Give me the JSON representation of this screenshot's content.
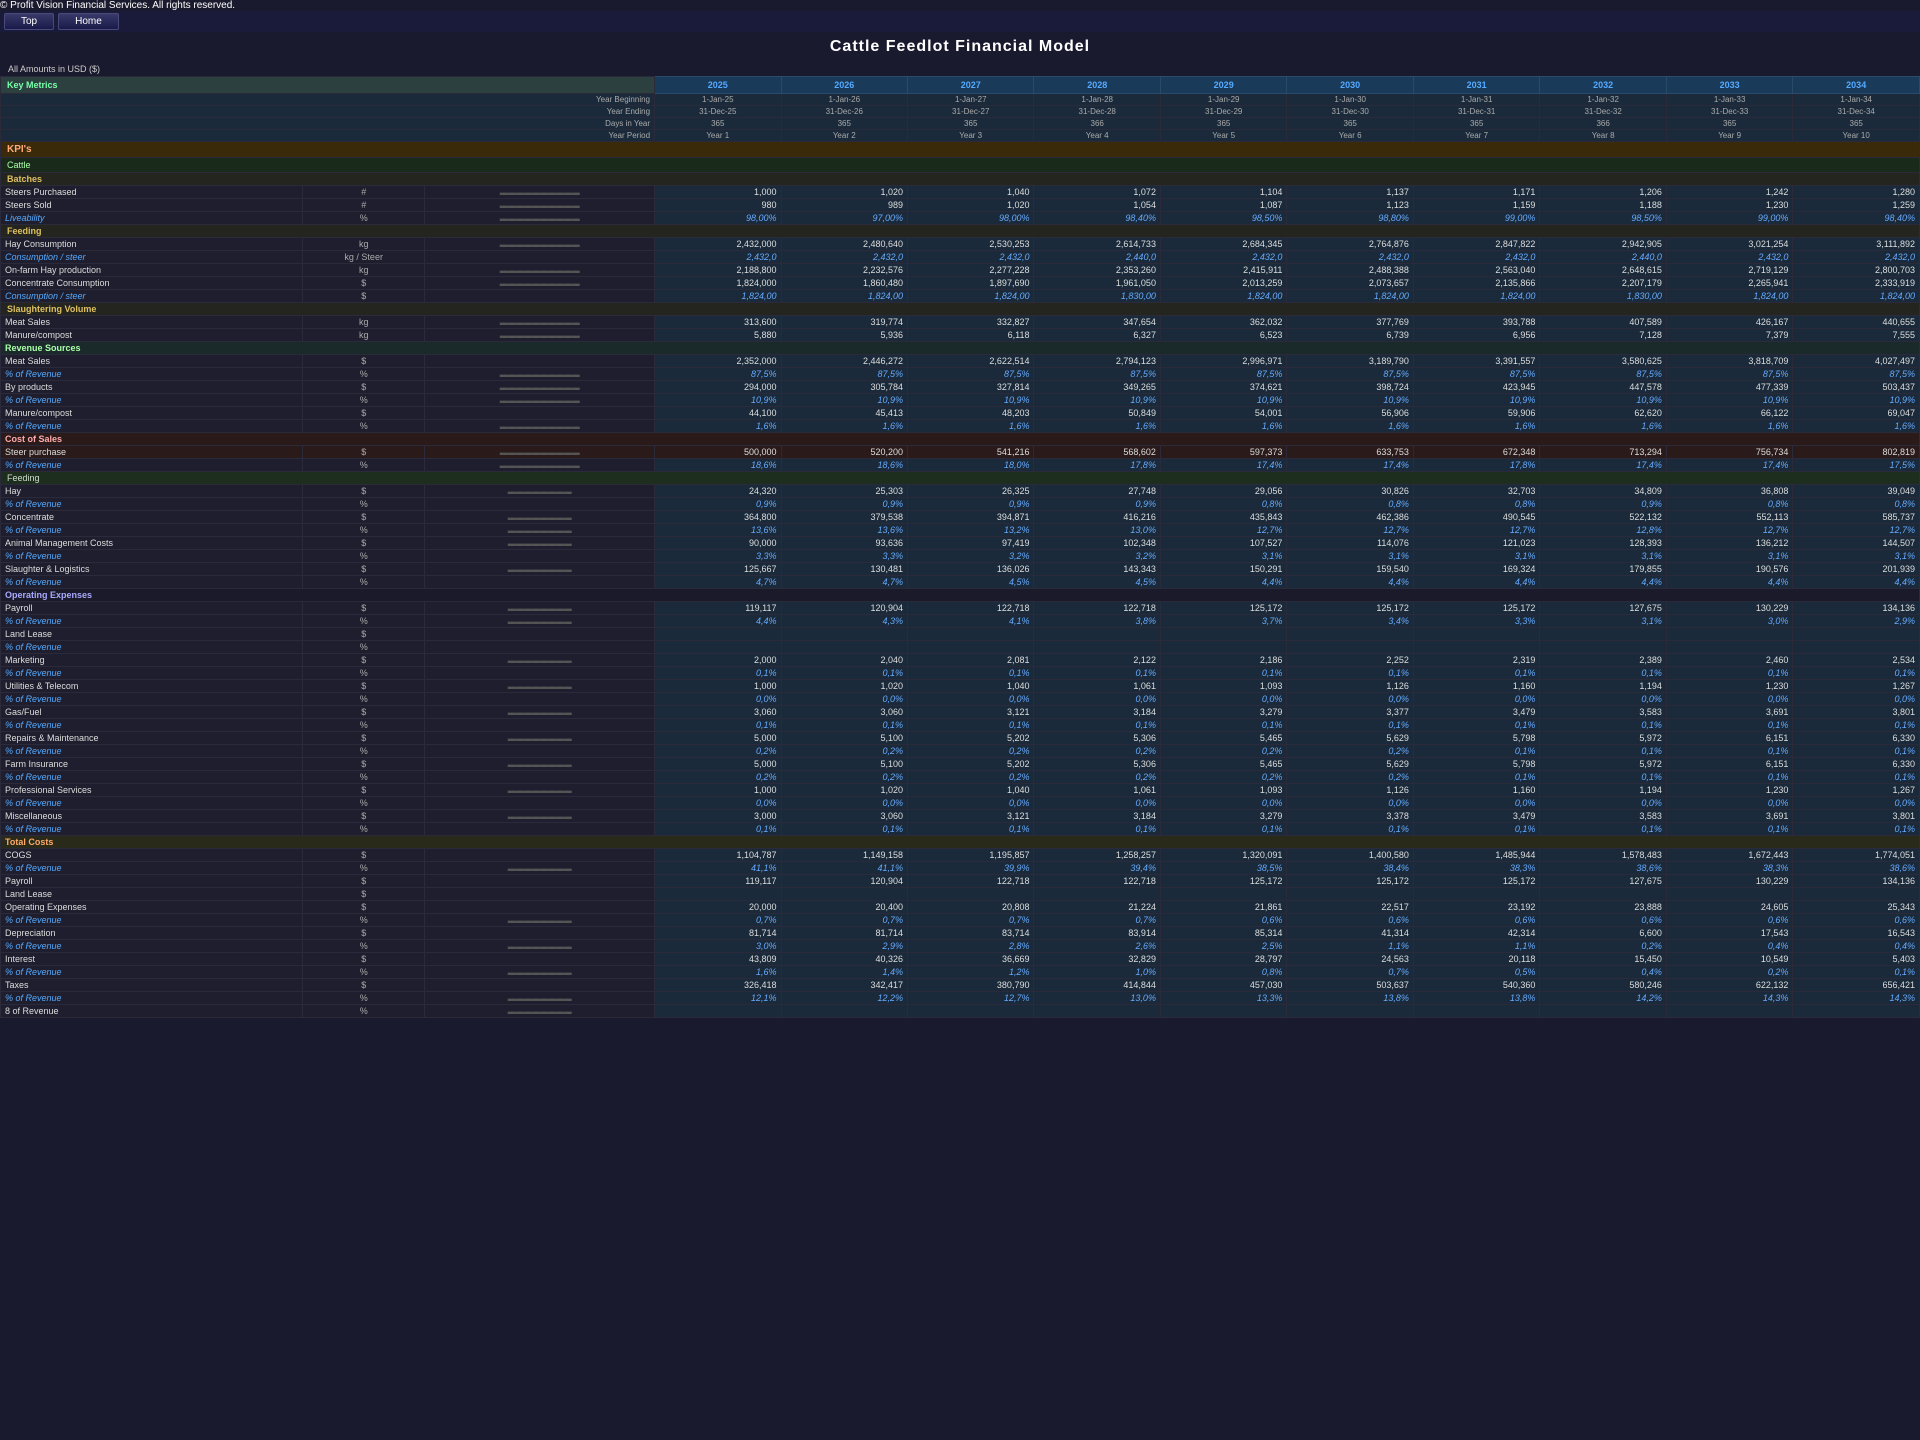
{
  "app": {
    "copyright": "© Profit Vision Financial Services. All rights reserved.",
    "nav": [
      "Top",
      "Home"
    ],
    "title": "Cattle Feedlot Financial Model",
    "currency": "All Amounts in USD ($)"
  },
  "header": {
    "years": [
      "2025",
      "2026",
      "2027",
      "2028",
      "2029",
      "2030",
      "2031",
      "2032",
      "2033",
      "2034"
    ],
    "year_beginning": [
      "1-Jan-25",
      "1-Jan-26",
      "1-Jan-27",
      "1-Jan-28",
      "1-Jan-29",
      "1-Jan-30",
      "1-Jan-31",
      "1-Jan-32",
      "1-Jan-33",
      "1-Jan-34"
    ],
    "year_ending": [
      "31-Dec-25",
      "31-Dec-26",
      "31-Dec-27",
      "31-Dec-28",
      "31-Dec-29",
      "31-Dec-30",
      "31-Dec-31",
      "31-Dec-32",
      "31-Dec-33",
      "31-Dec-34"
    ],
    "days_in_year": [
      "365",
      "365",
      "365",
      "366",
      "365",
      "365",
      "365",
      "366",
      "365",
      "365"
    ],
    "year_period": [
      "Year 1",
      "Year 2",
      "Year 3",
      "Year 4",
      "Year 5",
      "Year 6",
      "Year 7",
      "Year 8",
      "Year 9",
      "Year 10"
    ]
  },
  "key_metrics_label": "Key Metrics",
  "kpis_label": "KPI's",
  "cattle_label": "Cattle",
  "sections": {
    "batches": {
      "label": "Batches",
      "steers_purchased": {
        "label": "Steers Purchased",
        "unit": "#",
        "values": [
          "1,000",
          "1,020",
          "1,040",
          "1,072",
          "1,104",
          "1,137",
          "1,171",
          "1,206",
          "1,242",
          "1,280"
        ]
      },
      "steers_sold": {
        "label": "Steers Sold",
        "unit": "#",
        "values": [
          "980",
          "989",
          "1,020",
          "1,054",
          "1,087",
          "1,123",
          "1,159",
          "1,188",
          "1,230",
          "1,259"
        ]
      },
      "liveability": {
        "label": "Liveability",
        "unit": "%",
        "values": [
          "98,00%",
          "97,00%",
          "98,00%",
          "98,40%",
          "98,50%",
          "98,80%",
          "99,00%",
          "98,50%",
          "99,00%",
          "98,40%"
        ]
      }
    },
    "feeding": {
      "label": "Feeding",
      "hay_consumption": {
        "label": "Hay Consumption",
        "unit": "kg",
        "values": [
          "2,432,000",
          "2,480,640",
          "2,530,253",
          "2,614,733",
          "2,684,345",
          "2,764,876",
          "2,847,822",
          "2,942,905",
          "3,021,254",
          "3,111,892"
        ]
      },
      "consumption_steer_hay": {
        "label": "Consumption / steer",
        "unit": "kg / Steer",
        "values": [
          "2,432,0",
          "2,432,0",
          "2,432,0",
          "2,440,0",
          "2,432,0",
          "2,432,0",
          "2,432,0",
          "2,440,0",
          "2,432,0",
          "2,432,0"
        ]
      },
      "onfarm_hay": {
        "label": "On-farm Hay production",
        "unit": "kg",
        "values": [
          "2,188,800",
          "2,232,576",
          "2,277,228",
          "2,353,260",
          "2,415,911",
          "2,488,388",
          "2,563,040",
          "2,648,615",
          "2,719,129",
          "2,800,703"
        ]
      },
      "concentrate": {
        "label": "Concentrate Consumption",
        "unit": "$",
        "values": [
          "1,824,000",
          "1,860,480",
          "1,897,690",
          "1,961,050",
          "2,013,259",
          "2,073,657",
          "2,135,866",
          "2,207,179",
          "2,265,941",
          "2,333,919"
        ]
      },
      "consumption_steer_conc": {
        "label": "Consumption / steer",
        "unit": "$",
        "values": [
          "1,824,00",
          "1,824,00",
          "1,824,00",
          "1,830,00",
          "1,824,00",
          "1,824,00",
          "1,824,00",
          "1,830,00",
          "1,824,00",
          "1,824,00"
        ]
      }
    },
    "slaughtering": {
      "label": "Slaughtering Volume",
      "meat_sales": {
        "label": "Meat Sales",
        "unit": "kg",
        "values": [
          "313,600",
          "319,774",
          "332,827",
          "347,654",
          "362,032",
          "377,769",
          "393,788",
          "407,589",
          "426,167",
          "440,655"
        ]
      },
      "manure": {
        "label": "Manure/compost",
        "unit": "kg",
        "values": [
          "5,880",
          "5,936",
          "6,118",
          "6,327",
          "6,523",
          "6,739",
          "6,956",
          "7,128",
          "7,379",
          "7,555"
        ]
      }
    },
    "revenue_sources": {
      "label": "Revenue Sources",
      "meat_sales": {
        "label": "Meat Sales",
        "unit": "$",
        "values": [
          "2,352,000",
          "2,446,272",
          "2,622,514",
          "2,794,123",
          "2,996,971",
          "3,189,790",
          "3,391,557",
          "3,580,625",
          "3,818,709",
          "4,027,497"
        ]
      },
      "pct_revenue_meat": {
        "label": "% of Revenue",
        "unit": "%",
        "values": [
          "87,5%",
          "87,5%",
          "87,5%",
          "87,5%",
          "87,5%",
          "87,5%",
          "87,5%",
          "87,5%",
          "87,5%",
          "87,5%"
        ]
      },
      "by_products": {
        "label": "By products",
        "unit": "$",
        "values": [
          "294,000",
          "305,784",
          "327,814",
          "349,265",
          "374,621",
          "398,724",
          "423,945",
          "447,578",
          "477,339",
          "503,437"
        ]
      },
      "pct_revenue_byproducts": {
        "label": "% of Revenue",
        "unit": "%",
        "values": [
          "10,9%",
          "10,9%",
          "10,9%",
          "10,9%",
          "10,9%",
          "10,9%",
          "10,9%",
          "10,9%",
          "10,9%",
          "10,9%"
        ]
      },
      "manure_compost": {
        "label": "Manure/compost",
        "unit": "$",
        "values": [
          "44,100",
          "45,413",
          "48,203",
          "50,849",
          "54,001",
          "56,906",
          "59,906",
          "62,620",
          "66,122",
          "69,047"
        ]
      },
      "pct_revenue_manure": {
        "label": "% of Revenue",
        "unit": "%",
        "values": [
          "1,6%",
          "1,6%",
          "1,6%",
          "1,6%",
          "1,6%",
          "1,6%",
          "1,6%",
          "1,6%",
          "1,6%",
          "1,6%"
        ]
      }
    },
    "cost_of_sales": {
      "label": "Cost of Sales",
      "steer_purchase": {
        "label": "Steer purchase",
        "unit": "$",
        "values": [
          "500,000",
          "520,200",
          "541,216",
          "568,602",
          "597,373",
          "633,753",
          "672,348",
          "713,294",
          "756,734",
          "802,819"
        ]
      },
      "pct_steer": {
        "label": "% of Revenue",
        "unit": "%",
        "values": [
          "18,6%",
          "18,6%",
          "18,0%",
          "17,8%",
          "17,4%",
          "17,4%",
          "17,8%",
          "17,4%",
          "17,4%",
          "17,5%"
        ]
      },
      "feeding_hay": {
        "label": "Hay",
        "unit": "$",
        "values": [
          "24,320",
          "25,303",
          "26,325",
          "27,748",
          "29,056",
          "30,826",
          "32,703",
          "34,809",
          "36,808",
          "39,049"
        ]
      },
      "pct_hay": {
        "label": "% of Revenue",
        "unit": "%",
        "values": [
          "0,9%",
          "0,9%",
          "0,9%",
          "0,9%",
          "0,8%",
          "0,8%",
          "0,8%",
          "0,9%",
          "0,8%",
          "0,8%"
        ]
      },
      "concentrate_cost": {
        "label": "Concentrate",
        "unit": "$",
        "values": [
          "364,800",
          "379,538",
          "394,871",
          "416,216",
          "435,843",
          "462,386",
          "490,545",
          "522,132",
          "552,113",
          "585,737"
        ]
      },
      "pct_concentrate": {
        "label": "% of Revenue",
        "unit": "%",
        "values": [
          "13,6%",
          "13,6%",
          "13,2%",
          "13,0%",
          "12,7%",
          "12,7%",
          "12,7%",
          "12,8%",
          "12,7%",
          "12,7%"
        ]
      },
      "animal_mgmt": {
        "label": "Animal Management Costs",
        "unit": "$",
        "values": [
          "90,000",
          "93,636",
          "97,419",
          "102,348",
          "107,527",
          "114,076",
          "121,023",
          "128,393",
          "136,212",
          "144,507"
        ]
      },
      "pct_animal_mgmt": {
        "label": "% of Revenue",
        "unit": "%",
        "values": [
          "3,3%",
          "3,3%",
          "3,2%",
          "3,2%",
          "3,1%",
          "3,1%",
          "3,1%",
          "3,1%",
          "3,1%",
          "3,1%"
        ]
      },
      "slaughter_logistics": {
        "label": "Slaughter & Logistics",
        "unit": "$",
        "values": [
          "125,667",
          "130,481",
          "136,026",
          "143,343",
          "150,291",
          "159,540",
          "169,324",
          "179,855",
          "190,576",
          "201,939"
        ]
      },
      "pct_slaughter": {
        "label": "% of Revenue",
        "unit": "%",
        "values": [
          "4,7%",
          "4,7%",
          "4,5%",
          "4,5%",
          "4,4%",
          "4,4%",
          "4,4%",
          "4,4%",
          "4,4%",
          "4,4%"
        ]
      }
    },
    "operating_expenses": {
      "label": "Operating Expenses",
      "payroll": {
        "label": "Payroll",
        "unit": "$",
        "values": [
          "119,117",
          "120,904",
          "122,718",
          "122,718",
          "125,172",
          "125,172",
          "125,172",
          "127,675",
          "130,229",
          "134,136"
        ]
      },
      "pct_payroll": {
        "label": "% of Revenue",
        "unit": "%",
        "values": [
          "4,4%",
          "4,3%",
          "4,1%",
          "3,8%",
          "3,7%",
          "3,4%",
          "3,3%",
          "3,1%",
          "3,0%",
          "2,9%"
        ]
      },
      "land_lease": {
        "label": "Land Lease",
        "unit": "$",
        "values": [
          "",
          "",
          "",
          "",
          "",
          "",
          "",
          "",
          "",
          ""
        ]
      },
      "pct_land_lease": {
        "label": "% of Revenue",
        "unit": "%",
        "values": [
          "",
          "",
          "",
          "",
          "",
          "",
          "",
          "",
          "",
          ""
        ]
      },
      "marketing": {
        "label": "Marketing",
        "unit": "$",
        "values": [
          "2,000",
          "2,040",
          "2,081",
          "2,122",
          "2,186",
          "2,252",
          "2,319",
          "2,389",
          "2,460",
          "2,534"
        ]
      },
      "pct_marketing": {
        "label": "% of Revenue",
        "unit": "%",
        "values": [
          "0,1%",
          "0,1%",
          "0,1%",
          "0,1%",
          "0,1%",
          "0,1%",
          "0,1%",
          "0,1%",
          "0,1%",
          "0,1%"
        ]
      },
      "utilities_telecom": {
        "label": "Utilities & Telecom",
        "unit": "$",
        "values": [
          "1,000",
          "1,020",
          "1,040",
          "1,061",
          "1,093",
          "1,126",
          "1,160",
          "1,194",
          "1,230",
          "1,267"
        ]
      },
      "pct_utilities": {
        "label": "% of Revenue",
        "unit": "%",
        "values": [
          "0,0%",
          "0,0%",
          "0,0%",
          "0,0%",
          "0,0%",
          "0,0%",
          "0,0%",
          "0,0%",
          "0,0%",
          "0,0%"
        ]
      },
      "gas_fuel": {
        "label": "Gas/Fuel",
        "unit": "$",
        "values": [
          "3,060",
          "3,060",
          "3,121",
          "3,184",
          "3,279",
          "3,377",
          "3,479",
          "3,583",
          "3,691",
          "3,801"
        ]
      },
      "pct_gas": {
        "label": "% of Revenue",
        "unit": "%",
        "values": [
          "0,1%",
          "0,1%",
          "0,1%",
          "0,1%",
          "0,1%",
          "0,1%",
          "0,1%",
          "0,1%",
          "0,1%",
          "0,1%"
        ]
      },
      "repairs_maintenance": {
        "label": "Repairs & Maintenance",
        "unit": "$",
        "values": [
          "5,000",
          "5,100",
          "5,202",
          "5,306",
          "5,465",
          "5,629",
          "5,798",
          "5,972",
          "6,151",
          "6,330"
        ]
      },
      "pct_repairs": {
        "label": "% of Revenue",
        "unit": "%",
        "values": [
          "0,2%",
          "0,2%",
          "0,2%",
          "0,2%",
          "0,2%",
          "0,2%",
          "0,1%",
          "0,1%",
          "0,1%",
          "0,1%"
        ]
      },
      "farm_insurance": {
        "label": "Farm Insurance",
        "unit": "$",
        "values": [
          "5,000",
          "5,100",
          "5,202",
          "5,306",
          "5,465",
          "5,629",
          "5,798",
          "5,972",
          "6,151",
          "6,330"
        ]
      },
      "pct_farm_insurance": {
        "label": "% of Revenue",
        "unit": "%",
        "values": [
          "0,2%",
          "0,2%",
          "0,2%",
          "0,2%",
          "0,2%",
          "0,2%",
          "0,1%",
          "0,1%",
          "0,1%",
          "0,1%"
        ]
      },
      "professional_services": {
        "label": "Professional Services",
        "unit": "$",
        "values": [
          "1,000",
          "1,020",
          "1,040",
          "1,061",
          "1,093",
          "1,126",
          "1,160",
          "1,194",
          "1,230",
          "1,267"
        ]
      },
      "pct_professional": {
        "label": "% of Revenue",
        "unit": "%",
        "values": [
          "0,0%",
          "0,0%",
          "0,0%",
          "0,0%",
          "0,0%",
          "0,0%",
          "0,0%",
          "0,0%",
          "0,0%",
          "0,0%"
        ]
      },
      "miscellaneous": {
        "label": "Miscellaneous",
        "unit": "$",
        "values": [
          "3,000",
          "3,060",
          "3,121",
          "3,184",
          "3,279",
          "3,378",
          "3,479",
          "3,583",
          "3,691",
          "3,801"
        ]
      },
      "pct_misc": {
        "label": "% of Revenue",
        "unit": "%",
        "values": [
          "0,1%",
          "0,1%",
          "0,1%",
          "0,1%",
          "0,1%",
          "0,1%",
          "0,1%",
          "0,1%",
          "0,1%",
          "0,1%"
        ]
      }
    },
    "total_costs": {
      "label": "Total Costs",
      "cogs": {
        "label": "COGS",
        "unit": "$",
        "values": [
          "1,104,787",
          "1,149,158",
          "1,195,857",
          "1,258,257",
          "1,320,091",
          "1,400,580",
          "1,485,944",
          "1,578,483",
          "1,672,443",
          "1,774,051"
        ]
      },
      "pct_cogs": {
        "label": "% of Revenue",
        "unit": "%",
        "values": [
          "41,1%",
          "41,1%",
          "39,9%",
          "39,4%",
          "38,5%",
          "38,4%",
          "38,3%",
          "38,6%",
          "38,3%",
          "38,6%"
        ]
      },
      "payroll_total": {
        "label": "Payroll",
        "unit": "$",
        "values": [
          "119,117",
          "120,904",
          "122,718",
          "122,718",
          "125,172",
          "125,172",
          "125,172",
          "127,675",
          "130,229",
          "134,136"
        ]
      },
      "land_lease_total": {
        "label": "Land Lease",
        "unit": "$",
        "values": [
          "",
          "",
          "",
          "",
          "",
          "",
          "",
          "",
          "",
          ""
        ]
      },
      "op_expenses_total": {
        "label": "Operating Expenses",
        "unit": "$",
        "values": [
          "20,000",
          "20,400",
          "20,808",
          "21,224",
          "21,861",
          "22,517",
          "23,192",
          "23,888",
          "24,605",
          "25,343"
        ]
      },
      "pct_op_exp": {
        "label": "% of Revenue",
        "unit": "%",
        "values": [
          "0,7%",
          "0,7%",
          "0,7%",
          "0,7%",
          "0,6%",
          "0,6%",
          "0,6%",
          "0,6%",
          "0,6%",
          "0,6%"
        ]
      },
      "depreciation": {
        "label": "Depreciation",
        "unit": "$",
        "values": [
          "81,714",
          "81,714",
          "83,714",
          "83,914",
          "85,314",
          "41,314",
          "42,314",
          "6,600",
          "17,543",
          "16,543"
        ]
      },
      "pct_depreciation": {
        "label": "% of Revenue",
        "unit": "%",
        "values": [
          "3,0%",
          "2,9%",
          "2,8%",
          "2,6%",
          "2,5%",
          "1,1%",
          "1,1%",
          "0,2%",
          "0,4%",
          "0,4%"
        ]
      },
      "interest": {
        "label": "Interest",
        "unit": "$",
        "values": [
          "43,809",
          "40,326",
          "36,669",
          "32,829",
          "28,797",
          "24,563",
          "20,118",
          "15,450",
          "10,549",
          "5,403"
        ]
      },
      "pct_interest": {
        "label": "% of Revenue",
        "unit": "%",
        "values": [
          "1,6%",
          "1,4%",
          "1,2%",
          "1,0%",
          "0,8%",
          "0,7%",
          "0,5%",
          "0,4%",
          "0,2%",
          "0,1%"
        ]
      },
      "taxes": {
        "label": "Taxes",
        "unit": "$",
        "values": [
          "326,418",
          "342,417",
          "380,790",
          "414,844",
          "457,030",
          "503,637",
          "540,360",
          "580,246",
          "622,132",
          "656,421"
        ]
      },
      "pct_taxes": {
        "label": "% of Revenue",
        "unit": "%",
        "values": [
          "12,1%",
          "12,2%",
          "12,7%",
          "13,0%",
          "13,3%",
          "13,8%",
          "13,8%",
          "14,2%",
          "14,3%",
          "14,3%"
        ]
      },
      "pct_8_revenue": {
        "label": "8 of Revenue",
        "unit": "%",
        "values": [
          "",
          "",
          "",
          "",
          "",
          "",
          "",
          "",
          "",
          ""
        ]
      }
    }
  }
}
